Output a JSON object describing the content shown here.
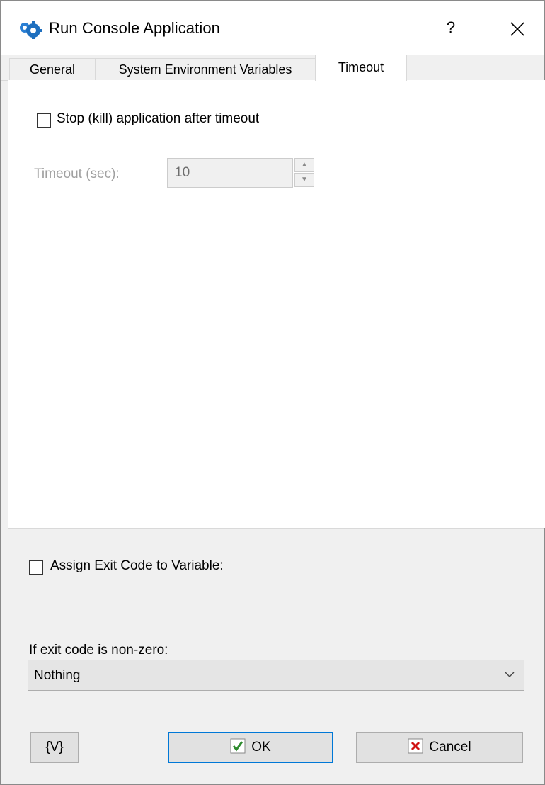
{
  "window": {
    "title": "Run Console Application",
    "help_label": "?",
    "close_label": "✕"
  },
  "tabs": [
    {
      "label": "General",
      "active": false
    },
    {
      "label": "System Environment Variables",
      "active": false
    },
    {
      "label": "Timeout",
      "active": true
    }
  ],
  "timeout_tab": {
    "stop_checkbox_label": "Stop (kill) application after timeout",
    "stop_checked": false,
    "timeout_label_first": "T",
    "timeout_label_rest": "imeout (sec):",
    "timeout_value": "10",
    "timeout_enabled": false
  },
  "exit_code": {
    "assign_label": "Assign Exit Code to Variable:",
    "assign_checked": false,
    "variable_value": "",
    "if_label_before": "I",
    "if_label_mnemonic": "f",
    "if_label_after": " exit code is non-zero:",
    "if_selected": "Nothing"
  },
  "buttons": {
    "variables_label": "{V}",
    "ok_mnemonic": "O",
    "ok_rest": "K",
    "cancel_mnemonic": "C",
    "cancel_rest": "ancel"
  },
  "colors": {
    "focus_border": "#0078d7",
    "check_green": "#2e8b2e",
    "cancel_red": "#d01010",
    "app_icon_blue": "#1e6fbf"
  }
}
